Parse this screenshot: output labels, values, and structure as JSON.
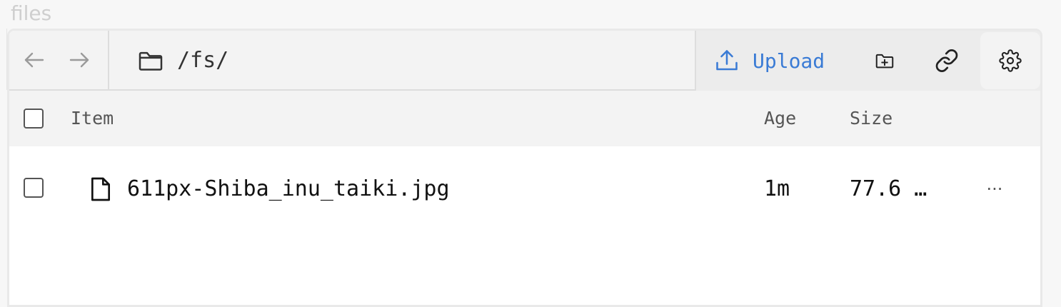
{
  "app": {
    "title": "files"
  },
  "toolbar": {
    "back_icon": "arrow-left-icon",
    "forward_icon": "arrow-right-icon",
    "path_icon": "folder-icon",
    "path": "/fs/",
    "upload_label": "Upload",
    "upload_icon": "upload-icon",
    "new_folder_icon": "folder-plus-icon",
    "link_icon": "link-icon",
    "settings_icon": "gear-icon",
    "accent_color": "#3a7bd5"
  },
  "table": {
    "columns": {
      "item": "Item",
      "age": "Age",
      "size": "Size"
    },
    "rows": [
      {
        "icon": "file-icon",
        "name": "611px-Shiba_inu_taiki.jpg",
        "age": "1m",
        "size": "77.6 …",
        "more": "···"
      }
    ]
  }
}
